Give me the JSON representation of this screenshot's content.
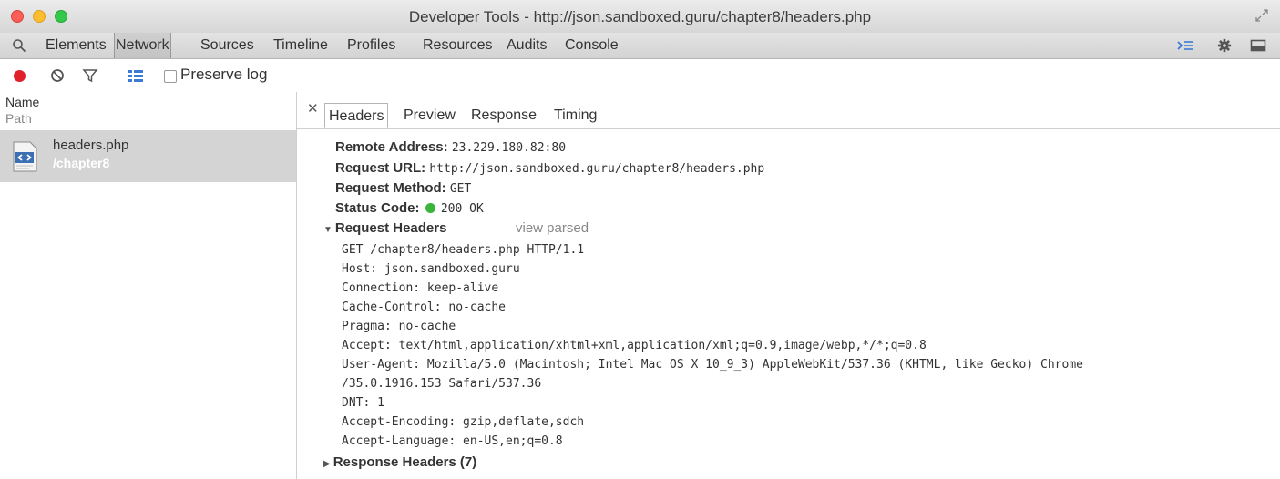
{
  "window": {
    "title": "Developer Tools - http://json.sandboxed.guru/chapter8/headers.php",
    "traffic_lights": [
      "close",
      "minimize",
      "zoom"
    ]
  },
  "tabs": [
    "Elements",
    "Network",
    "Sources",
    "Timeline",
    "Profiles",
    "Resources",
    "Audits",
    "Console"
  ],
  "active_tab": "Network",
  "toolbar_icons": [
    "search-icon",
    "console-drawer-icon",
    "settings-gear-icon",
    "dock-icon"
  ],
  "network_toolbar": {
    "record_color": "#e0202a",
    "preserve_log_label": "Preserve log",
    "preserve_log_checked": false
  },
  "request_list": {
    "col_name": "Name",
    "col_path": "Path",
    "items": [
      {
        "name": "headers.php",
        "path": "/chapter8"
      }
    ]
  },
  "detail_tabs": [
    "Headers",
    "Preview",
    "Response",
    "Timing"
  ],
  "active_detail_tab": "Headers",
  "general": {
    "remote_address_label": "Remote Address:",
    "remote_address": "23.229.180.82:80",
    "request_url_label": "Request URL:",
    "request_url": "http://json.sandboxed.guru/chapter8/headers.php",
    "request_method_label": "Request Method:",
    "request_method": "GET",
    "status_code_label": "Status Code:",
    "status_code": "200 OK",
    "status_color": "#38b53a"
  },
  "request_headers": {
    "title": "Request Headers",
    "view_parsed": "view parsed",
    "lines": [
      "GET /chapter8/headers.php HTTP/1.1",
      "Host: json.sandboxed.guru",
      "Connection: keep-alive",
      "Cache-Control: no-cache",
      "Pragma: no-cache",
      "Accept: text/html,application/xhtml+xml,application/xml;q=0.9,image/webp,*/*;q=0.8",
      "User-Agent: Mozilla/5.0 (Macintosh; Intel Mac OS X 10_9_3) AppleWebKit/537.36 (KHTML, like Gecko) Chrome",
      "/35.0.1916.153 Safari/537.36",
      "DNT: 1",
      "Accept-Encoding: gzip,deflate,sdch",
      "Accept-Language: en-US,en;q=0.8"
    ]
  },
  "response_headers": {
    "title": "Response Headers (7)"
  }
}
